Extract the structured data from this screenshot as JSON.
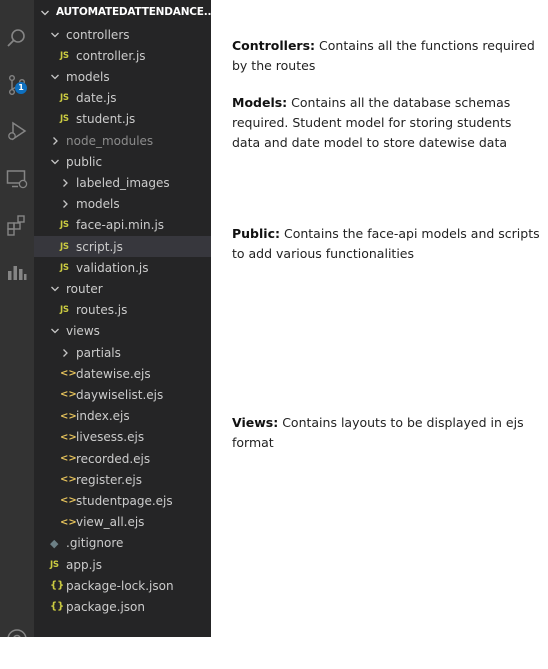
{
  "explorer": {
    "project_title": "AUTOMATEDATTENDANCE...",
    "rows": [
      {
        "label": "controllers",
        "type": "folder-open",
        "depth": 1
      },
      {
        "label": "controller.js",
        "type": "js",
        "depth": 2
      },
      {
        "label": "models",
        "type": "folder-open",
        "depth": 1
      },
      {
        "label": "date.js",
        "type": "js",
        "depth": 2
      },
      {
        "label": "student.js",
        "type": "js",
        "depth": 2
      },
      {
        "label": "node_modules",
        "type": "folder-closed-dim",
        "depth": 1
      },
      {
        "label": "public",
        "type": "folder-open",
        "depth": 1
      },
      {
        "label": "labeled_images",
        "type": "folder-closed",
        "depth": 2
      },
      {
        "label": "models",
        "type": "folder-closed",
        "depth": 2
      },
      {
        "label": "face-api.min.js",
        "type": "js",
        "depth": 2
      },
      {
        "label": "script.js",
        "type": "js",
        "depth": 2,
        "selected": true
      },
      {
        "label": "validation.js",
        "type": "js",
        "depth": 2
      },
      {
        "label": "router",
        "type": "folder-open",
        "depth": 1
      },
      {
        "label": "routes.js",
        "type": "js",
        "depth": 2
      },
      {
        "label": "views",
        "type": "folder-open",
        "depth": 1
      },
      {
        "label": "partials",
        "type": "folder-closed",
        "depth": 2
      },
      {
        "label": "datewise.ejs",
        "type": "ejs",
        "depth": 2
      },
      {
        "label": "daywiselist.ejs",
        "type": "ejs",
        "depth": 2
      },
      {
        "label": "index.ejs",
        "type": "ejs",
        "depth": 2
      },
      {
        "label": "livesess.ejs",
        "type": "ejs",
        "depth": 2
      },
      {
        "label": "recorded.ejs",
        "type": "ejs",
        "depth": 2
      },
      {
        "label": "register.ejs",
        "type": "ejs",
        "depth": 2
      },
      {
        "label": "studentpage.ejs",
        "type": "ejs",
        "depth": 2
      },
      {
        "label": "view_all.ejs",
        "type": "ejs",
        "depth": 2
      },
      {
        "label": ".gitignore",
        "type": "git",
        "depth": 1
      },
      {
        "label": "app.js",
        "type": "js",
        "depth": 1
      },
      {
        "label": "package-lock.json",
        "type": "json",
        "depth": 1
      },
      {
        "label": "package.json",
        "type": "json",
        "depth": 1
      }
    ],
    "icons": {
      "js": "JS",
      "ejs": "<>",
      "json": "{}",
      "git": "◆"
    }
  },
  "activity_bar": {
    "items": [
      "search-icon",
      "source-control-icon",
      "run-debug-icon",
      "remote-explorer-icon",
      "extensions-icon",
      "chart-icon",
      "account-icon"
    ],
    "source_control_badge": "1"
  },
  "annotations": [
    {
      "term": "Controllers:",
      "text": "Contains all the functions required by the routes"
    },
    {
      "term": "Models:",
      "text": "Contains all the database schemas required. Student model for storing students data and date model to store datewise data"
    },
    {
      "term": "Public:",
      "text": "Contains the face-api models and scripts to add various functionalities"
    },
    {
      "term": "Views:",
      "text": "Contains layouts to be displayed in ejs format"
    }
  ],
  "colors": {
    "activity_bar": "#333333",
    "sidebar": "#252526",
    "selected_row": "#37373d",
    "js_icon": "#cbcb41",
    "badge": "#0e70c0"
  }
}
